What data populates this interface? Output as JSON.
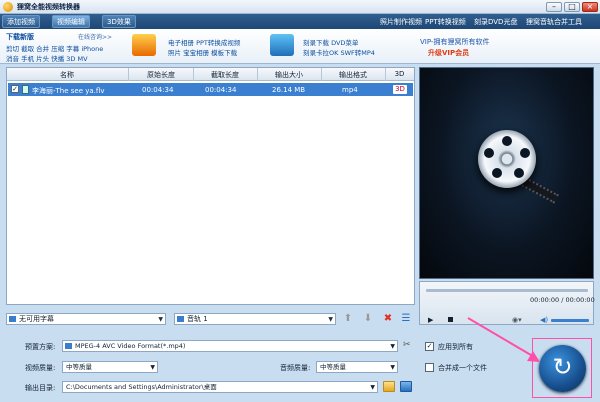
{
  "window": {
    "title": "狸窝全能视频转换器",
    "minimize": "–",
    "maximize": "□",
    "close": "×"
  },
  "tabs": [
    {
      "label": "添加视频",
      "active": false
    },
    {
      "label": "视频编辑",
      "active": true
    },
    {
      "label": "3D效果",
      "active": false
    }
  ],
  "top_links": [
    "照片制作视频",
    "PPT转换视频",
    "刻录DVD光盘",
    "狸窝音轨合并工具"
  ],
  "promo": {
    "download_label": "下载新版",
    "forum": "在线咨询>>",
    "row1": "剪切 截取 合并 压缩 字幕 iPhone",
    "row2": "消音 手机 片头 快播 3D MV",
    "block1_line1": "电子相册 PPT转换成视频",
    "block1_line2": "照片 宝宝相册 模板下载",
    "block2_line1": "刻录下载 DVD菜单",
    "block2_line2": "刻录卡拉OK SWF转MP4",
    "vip_line1": "VIP-拥有狸窝所有软件",
    "vip_line2": "升级VIP会员"
  },
  "file_list": {
    "columns": [
      "名称",
      "原始长度",
      "截取长度",
      "输出大小",
      "输出格式",
      "3D"
    ],
    "rows": [
      {
        "checked": "✓",
        "name": "李海丽-The see ya.flv",
        "original_length": "00:04:34",
        "clip_length": "00:04:34",
        "output_size": "26.14 MB",
        "format": "mp4",
        "badge_3d": "3D"
      }
    ]
  },
  "subtitle_bar": {
    "subtitle": "无可用字幕",
    "audio": "音轨 1",
    "up": "⬆",
    "down": "⬇",
    "delete": "✖",
    "list": "☰"
  },
  "player": {
    "time": "00:00:00 / 00:00:00",
    "play": "▶",
    "camera": "◉▾",
    "volume": "◀)"
  },
  "settings": {
    "preset_label": "预置方案:",
    "preset_value": "MPEG-4 AVC Video Format(*.mp4)",
    "video_quality_label": "视频质量:",
    "video_quality_value": "中等质量",
    "audio_quality_label": "音频质量:",
    "audio_quality_value": "中等质量",
    "output_label": "输出目录:",
    "output_value": "C:\\Documents and Settings\\Administrator\\桌面",
    "apply_all": "应用到所有",
    "apply_all_checked": "✓",
    "merge_one": "合并成一个文件",
    "merge_checked": ""
  },
  "convert_button": "↻",
  "colors": {
    "selection": "#3b7fd0",
    "annotation": "#ff4fa8",
    "vip": "#e03a12"
  }
}
